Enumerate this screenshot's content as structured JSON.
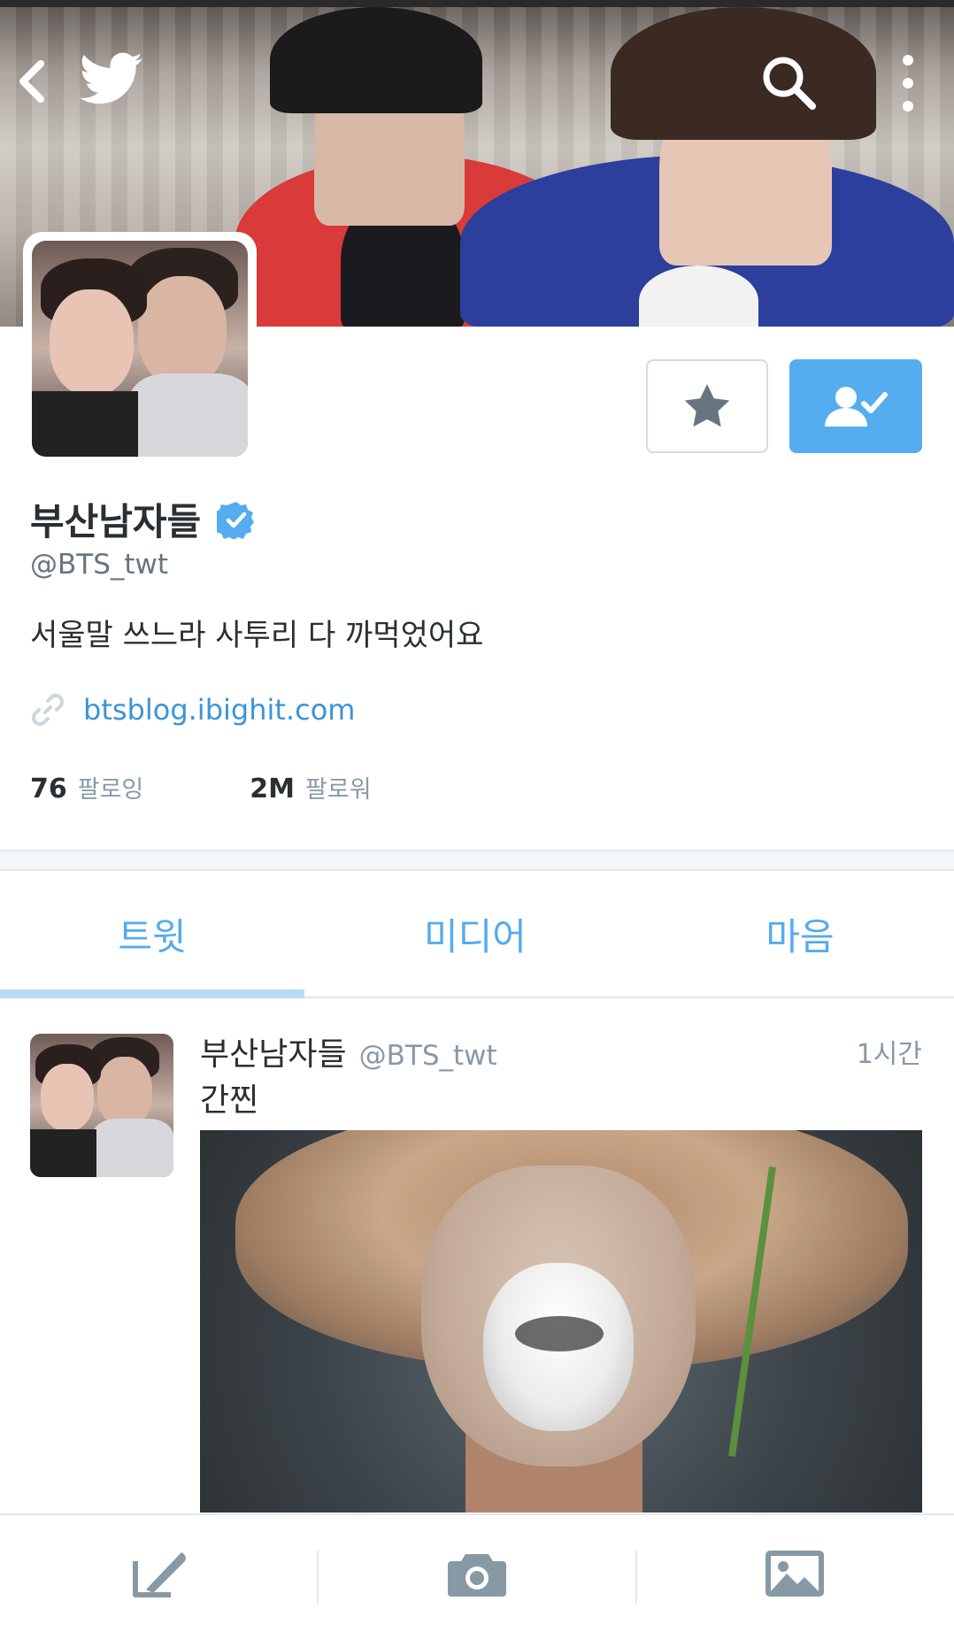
{
  "header": {
    "back": "back-icon",
    "logo": "twitter-bird-icon",
    "search": "search-icon",
    "more": "more-vertical-icon"
  },
  "profile": {
    "name": "부산남자들",
    "verified": true,
    "handle": "@BTS_twt",
    "bio": "서울말 쓰느라 사투리 다 까먹었어요",
    "link": "btsblog.ibighit.com",
    "following_count": "76",
    "following_label": "팔로잉",
    "followers_count": "2M",
    "followers_label": "팔로워"
  },
  "actions": {
    "favorite": "star-icon",
    "following": "person-check-icon",
    "accent_color": "#55acee"
  },
  "tabs": [
    {
      "label": "트윗",
      "active": true
    },
    {
      "label": "미디어",
      "active": false
    },
    {
      "label": "마음",
      "active": false
    }
  ],
  "tweet": {
    "name": "부산남자들",
    "handle": "@BTS_twt",
    "time": "1시간",
    "text": "간찐"
  },
  "bottom_bar": [
    {
      "icon": "compose-icon"
    },
    {
      "icon": "camera-icon"
    },
    {
      "icon": "image-icon"
    }
  ]
}
